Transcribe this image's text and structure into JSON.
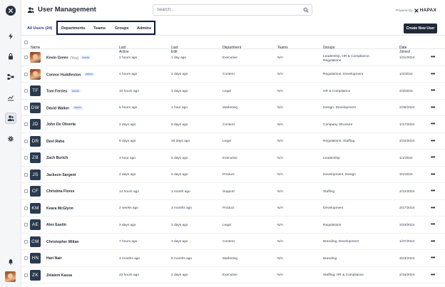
{
  "header": {
    "title": "User Management",
    "search_placeholder": "Search...",
    "powered_by": "Powered by",
    "brand": "HAPAX"
  },
  "tabs": {
    "all_users": "All Users (24)",
    "items": [
      "Departments",
      "Teams",
      "Groups",
      "Admins"
    ]
  },
  "actions": {
    "create_user": "Create New User"
  },
  "sidebar": {
    "icons": [
      "logo-icon",
      "lightning-icon",
      "lock-icon",
      "network-icon",
      "chart-icon",
      "users-icon",
      "gear-icon",
      "bell-icon"
    ]
  },
  "table": {
    "columns": [
      "Name",
      "Last Active",
      "Last Edit",
      "Department",
      "Teams",
      "Groups",
      "Date Joined"
    ],
    "rows": [
      {
        "initials": "",
        "photo": true,
        "name": "Kevin Green",
        "you": "(You)",
        "admin": "Admin",
        "last_active": "2 hours ago",
        "last_edit": "1 day ago",
        "department": "Executive",
        "teams": "N/A",
        "groups": "Leadership, HR & Compliance, Regulations",
        "date_joined": "1/21/2024"
      },
      {
        "initials": "",
        "photo": true,
        "name": "Connor Huddleston",
        "you": "",
        "admin": "Admin",
        "last_active": "4 hours ago",
        "last_edit": "2 days ago",
        "department": "Content",
        "teams": "N/A",
        "groups": "Regulations, Development",
        "date_joined": "1/4/2024"
      },
      {
        "initials": "TF",
        "photo": false,
        "name": "Tom Ferries",
        "you": "",
        "admin": "Admin",
        "last_active": "10 hours ago",
        "last_edit": "3 days ago",
        "department": "Legal",
        "teams": "N/A",
        "groups": "HR & Compliance",
        "date_joined": "2/3/2024"
      },
      {
        "initials": "DW",
        "photo": false,
        "name": "David Walker",
        "you": "",
        "admin": "Admin",
        "last_active": "5 hours ago",
        "last_edit": "1 hour ago",
        "department": "Marketing",
        "teams": "N/A",
        "groups": "Design, Development",
        "date_joined": "2/28/2024"
      },
      {
        "initials": "JD",
        "photo": false,
        "name": "John De Oliveria",
        "you": "",
        "admin": "",
        "last_active": "2 days ago",
        "last_edit": "6 days ago",
        "department": "Content",
        "teams": "N/A",
        "groups": "Company Structure",
        "date_joined": "1/17/2024"
      },
      {
        "initials": "DR",
        "photo": false,
        "name": "Devi Raha",
        "you": "",
        "admin": "",
        "last_active": "5 days ago",
        "last_edit": "15 days ago",
        "department": "Legal",
        "teams": "N/A",
        "groups": "Regulations, Staffing",
        "date_joined": "2/22/2024"
      },
      {
        "initials": "ZB",
        "photo": false,
        "name": "Zach Burtch",
        "you": "",
        "admin": "",
        "last_active": "3 hour ago",
        "last_edit": "2 days ago",
        "department": "Executive",
        "teams": "N/A",
        "groups": "Leadership",
        "date_joined": "1/1/2024"
      },
      {
        "initials": "JS",
        "photo": false,
        "name": "Jackson Sargent",
        "you": "",
        "admin": "",
        "last_active": "2 days ago",
        "last_edit": "2 days ago",
        "department": "Product",
        "teams": "N/A",
        "groups": "Development, Design",
        "date_joined": "3/1/2024"
      },
      {
        "initials": "CF",
        "photo": false,
        "name": "Christina Flores",
        "you": "",
        "admin": "",
        "last_active": "14 hours ago",
        "last_edit": "1 month ago",
        "department": "Support",
        "teams": "N/A",
        "groups": "Staffing",
        "date_joined": "2/12/2024"
      },
      {
        "initials": "KM",
        "photo": false,
        "name": "Keara McGlynn",
        "you": "",
        "admin": "",
        "last_active": "2 weeks ago",
        "last_edit": "3 months ago",
        "department": "Product",
        "teams": "N/A",
        "groups": "Development",
        "date_joined": "2/17/2024"
      },
      {
        "initials": "AE",
        "photo": false,
        "name": "Alex Eastin",
        "you": "",
        "admin": "",
        "last_active": "2 days ago",
        "last_edit": "2 days ago",
        "department": "Legal",
        "teams": "N/A",
        "groups": "Regulations",
        "date_joined": "2/23/2024"
      },
      {
        "initials": "CM",
        "photo": false,
        "name": "Christopher Milian",
        "you": "",
        "admin": "",
        "last_active": "7 hours ago",
        "last_edit": "3 days ago",
        "department": "Content",
        "teams": "N/A",
        "groups": "Branding, Development",
        "date_joined": "1/27/2024"
      },
      {
        "initials": "HN",
        "photo": false,
        "name": "Hari Nair",
        "you": "",
        "admin": "",
        "last_active": "3 months ago",
        "last_edit": "5 months ago",
        "department": "Marketing",
        "teams": "N/A",
        "groups": "Branding",
        "date_joined": "3/23/2024"
      },
      {
        "initials": "ZK",
        "photo": false,
        "name": "Zelalem Kassa",
        "you": "",
        "admin": "",
        "last_active": "23 hours ago",
        "last_edit": "2 days ago",
        "department": "Executive",
        "teams": "N/A",
        "groups": "Staffing, HR & Compliance",
        "date_joined": "2/16/2024"
      }
    ]
  },
  "colors": {
    "accent": "#1f3a8a",
    "dark": "#1f2a37",
    "highlight_border": "#0b1640"
  }
}
